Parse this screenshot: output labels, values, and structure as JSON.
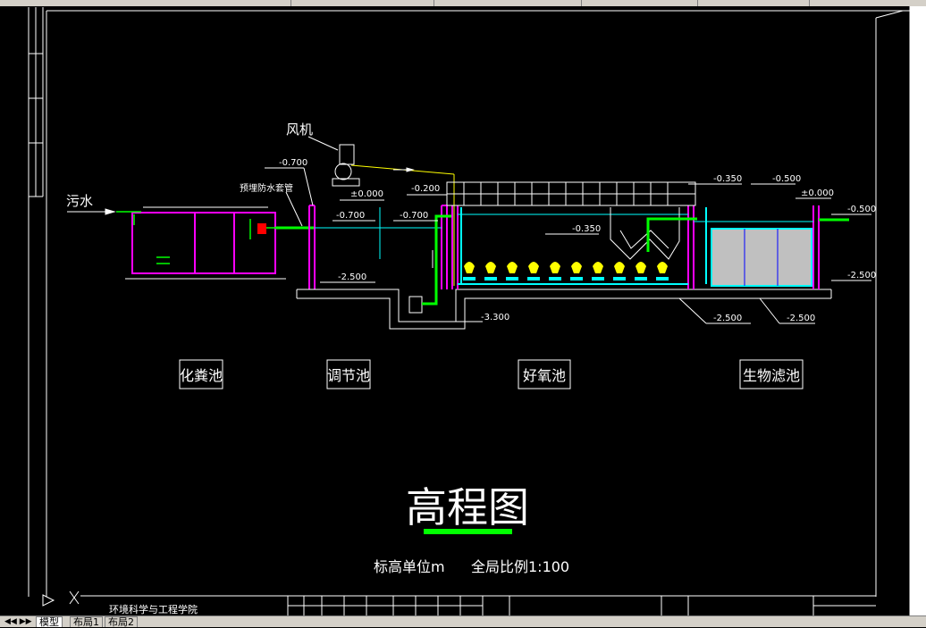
{
  "drawing": {
    "labels": {
      "inlet": "污水",
      "blower": "风机",
      "sleeve": "预埋防水套管",
      "title": "高程图",
      "units": "标高单位m",
      "scale": "全局比例1:100"
    },
    "tanks": [
      "化粪池",
      "调节池",
      "好氧池",
      "生物滤池"
    ],
    "elevations": {
      "e1": "-0.700",
      "e2": "±0.000",
      "e3": "-0.700",
      "e4": "-0.700",
      "e5": "-0.200",
      "e6": "-2.500",
      "e7": "-3.300",
      "e8": "-0.350",
      "e9": "-0.350",
      "e10": "-0.500",
      "e11": "±0.000",
      "e12": "-0.500",
      "e13": "-2.500",
      "e14": "-2.500",
      "e15": "-2.500"
    },
    "title_block": {
      "school": "环境科学与工程学院"
    },
    "colors": {
      "wall": "#ff00ff",
      "pipe": "#00ff00",
      "water": "#00ffff",
      "aerator": "#ffff00",
      "leader": "#ffffff",
      "title_underline": "#00ff00"
    }
  },
  "tabs": [
    "模型",
    "布局1",
    "布局2"
  ]
}
